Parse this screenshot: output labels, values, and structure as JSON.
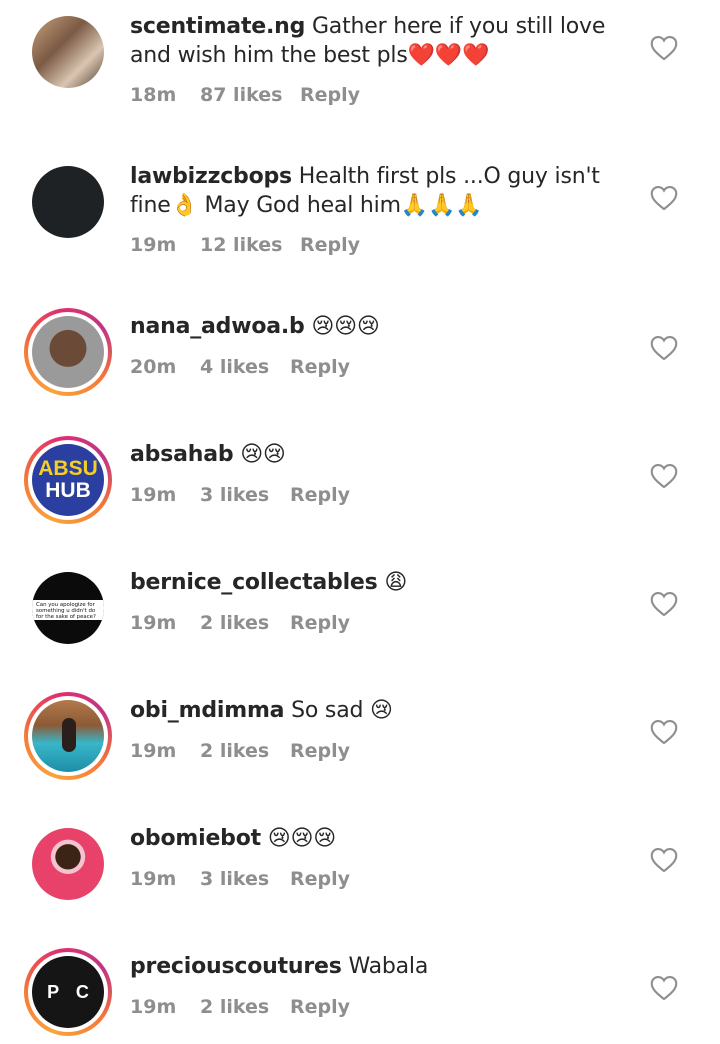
{
  "comments": [
    {
      "username": "scentimate.ng",
      "text": "Gather here if you still love and wish him the best pls❤️❤️❤️",
      "time": "18m",
      "likes": "87 likes",
      "reply": "Reply",
      "avatar": "group-photo"
    },
    {
      "username": "lawbizzcbops",
      "text": "Health first pls ...O guy isn't fine👌 May God heal him🙏🙏🙏",
      "time": "19m",
      "likes": "12 likes",
      "reply": "Reply",
      "avatar": "logo-dark"
    },
    {
      "username": "nana_adwoa.b",
      "text": "😢😢😢",
      "time": "20m",
      "likes": "4 likes",
      "reply": "Reply",
      "avatar": "portrait"
    },
    {
      "username": "absahab",
      "text": "😢😢",
      "time": "19m",
      "likes": "3 likes",
      "reply": "Reply",
      "avatar": "absu-hub-logo",
      "avatar_text": [
        "ABSU",
        "HUB"
      ]
    },
    {
      "username": "bernice_collectables",
      "text": "😩",
      "time": "19m",
      "likes": "2 likes",
      "reply": "Reply",
      "avatar": "text-image",
      "avatar_text": "Can you apologize for something u didn't do for the sake of peace?"
    },
    {
      "username": "obi_mdimma",
      "text": "So sad 😢",
      "time": "19m",
      "likes": "2 likes",
      "reply": "Reply",
      "avatar": "pool-photo"
    },
    {
      "username": "obomiebot",
      "text": "😢😢😢",
      "time": "19m",
      "likes": "3 likes",
      "reply": "Reply",
      "avatar": "portrait-pink"
    },
    {
      "username": "preciouscoutures",
      "text": "Wabala",
      "time": "19m",
      "likes": "2 likes",
      "reply": "Reply",
      "avatar": "pc-logo",
      "avatar_text": "P C"
    }
  ],
  "colors": {
    "text": "#262626",
    "meta": "#8e8e8e",
    "heart_outline": "#8e8e8e"
  },
  "icons": {
    "like": "heart-outline-icon"
  }
}
